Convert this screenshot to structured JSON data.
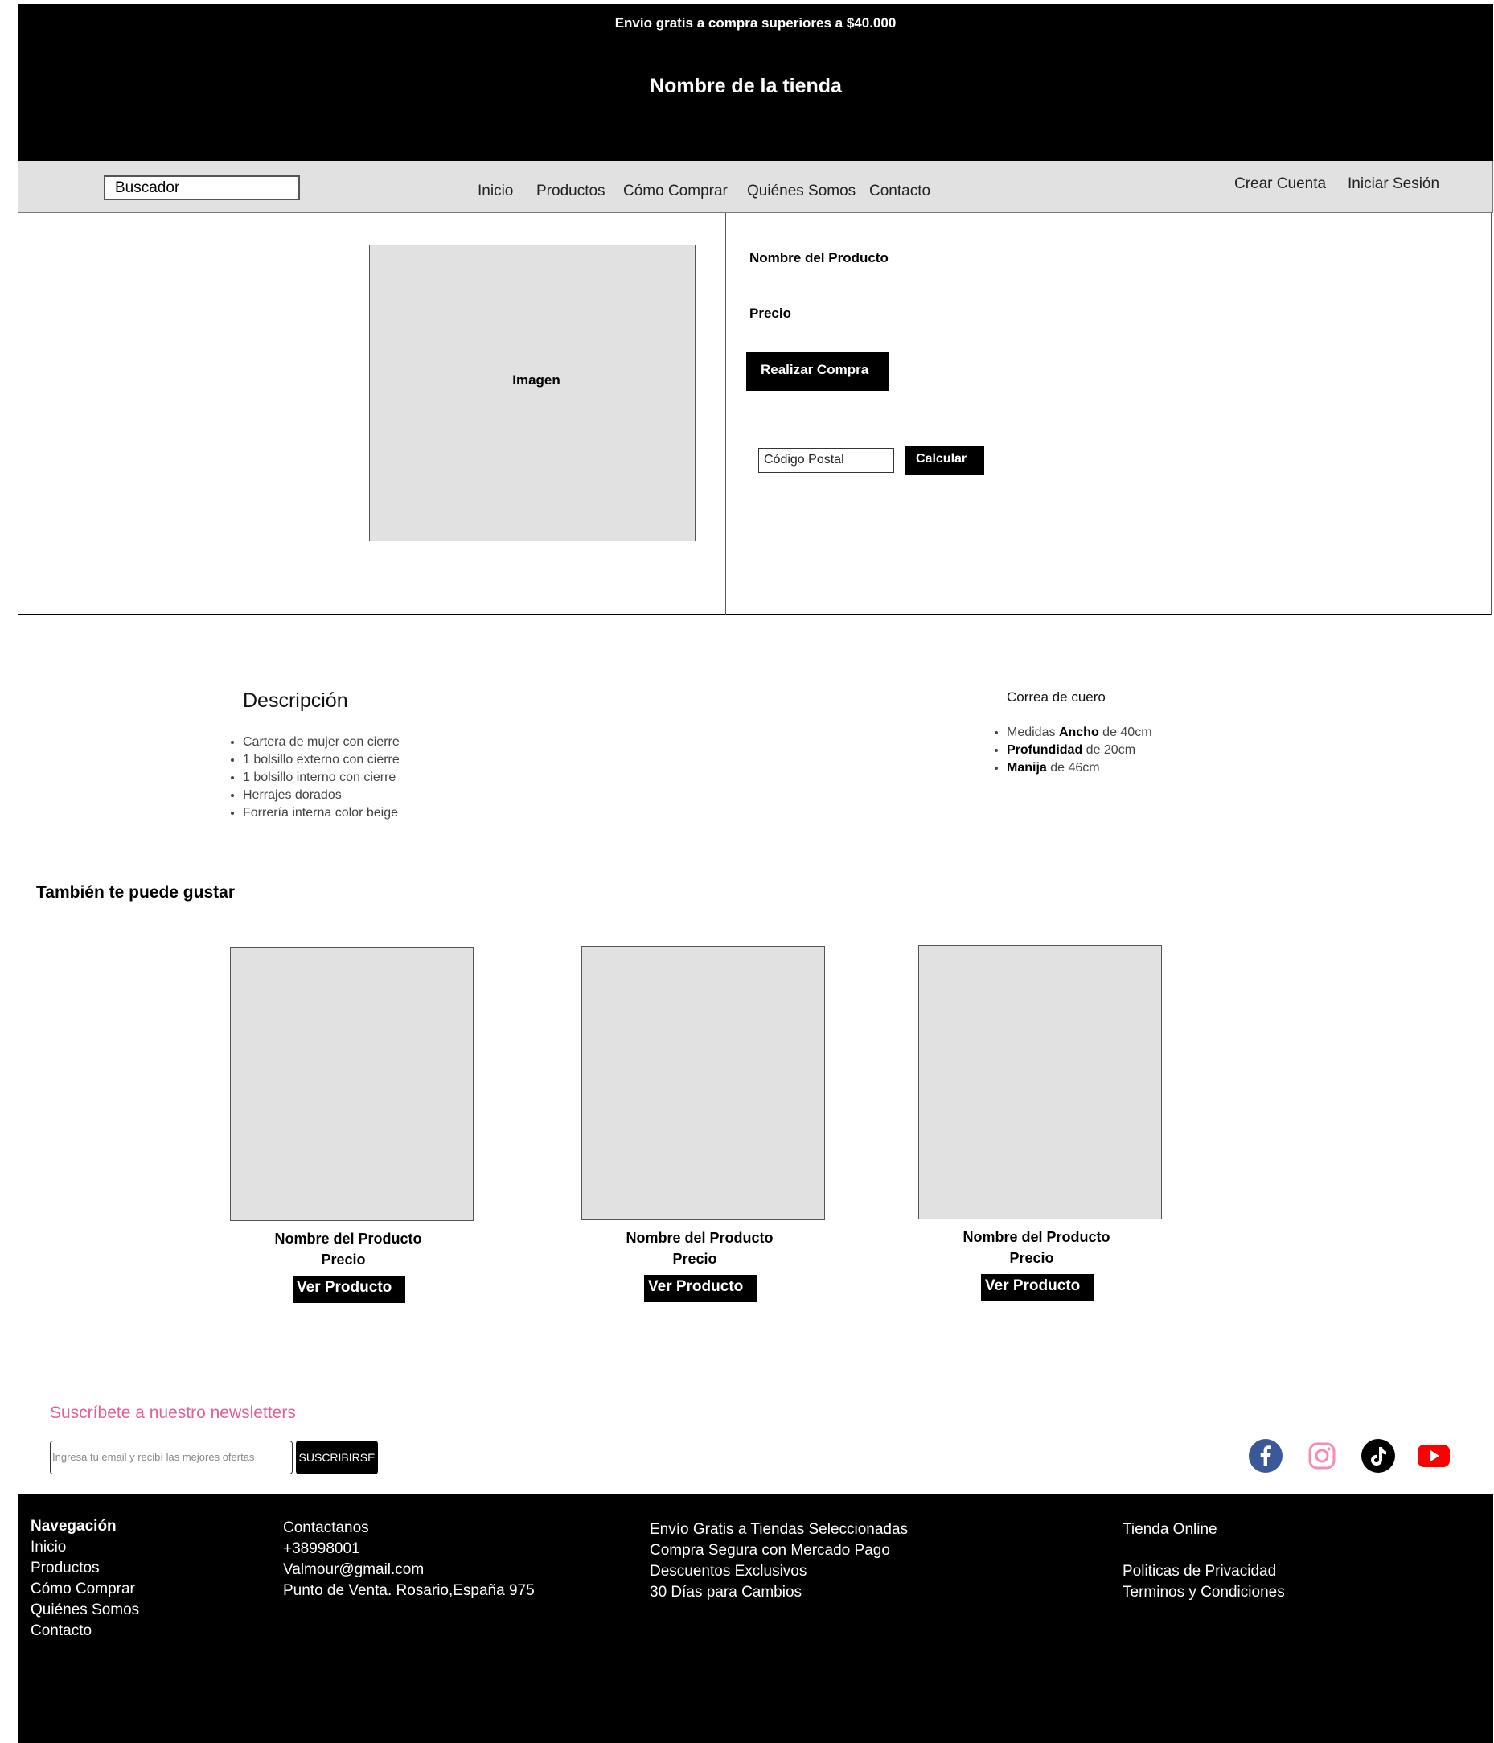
{
  "header": {
    "promo": "Envío gratis a compra superiores a $40.000",
    "store_name": "Nombre de la tienda"
  },
  "nav": {
    "search_placeholder": "Buscador",
    "links": [
      "Inicio",
      "Productos",
      "Cómo Comprar",
      "Quiénes Somos",
      "Contacto"
    ],
    "account": [
      "Crear Cuenta",
      "Iniciar Sesión"
    ]
  },
  "product": {
    "image_label": "Imagen",
    "name": "Nombre del Producto",
    "price": "Precio",
    "buy_button": "Realizar Compra",
    "postal_placeholder": "Código Postal",
    "calc_button": "Calcular"
  },
  "description": {
    "title": "Descripción",
    "items": [
      "Cartera de mujer con cierre",
      "1 bolsillo externo con cierre",
      "1 bolsillo interno con cierre",
      "Herrajes dorados",
      "Forrería interna color beige"
    ],
    "specs_title": "Correa de cuero",
    "specs": [
      {
        "label": "Medidas",
        "bold": "Ancho",
        "rest": " de 40cm"
      },
      {
        "label": "",
        "bold": "Profundidad",
        "rest": " de 20cm"
      },
      {
        "label": "",
        "bold": "Manija",
        "rest": " de 46cm"
      }
    ]
  },
  "related": {
    "title": "También te puede gustar",
    "cards": [
      {
        "name": "Nombre del Producto",
        "price": "Precio",
        "button": "Ver Producto"
      },
      {
        "name": "Nombre del Producto",
        "price": "Precio",
        "button": "Ver Producto"
      },
      {
        "name": "Nombre del Producto",
        "price": "Precio",
        "button": "Ver Producto"
      }
    ]
  },
  "newsletter": {
    "title": "Suscríbete a nuestro newsletters",
    "placeholder": "Ingresa tu email y recibí las mejores ofertas",
    "button": "SUSCRIBIRSE",
    "title_color": "#e0609a"
  },
  "social": [
    {
      "icon": "facebook-icon",
      "color": "#3b5998"
    },
    {
      "icon": "instagram-icon",
      "color": "#f48cb4"
    },
    {
      "icon": "tiktok-icon",
      "color": "#000000"
    },
    {
      "icon": "youtube-icon",
      "color": "#ff0000"
    }
  ],
  "footer": {
    "nav_title": "Navegación",
    "nav_links": [
      "Inicio",
      "Productos",
      "Cómo Comprar",
      "Quiénes Somos",
      "Contacto"
    ],
    "contact": [
      "Contactanos",
      "+38998001",
      "Valmour@gmail.com",
      "Punto de Venta. Rosario,España 975"
    ],
    "benefits": [
      "Envío Gratis a Tiendas Seleccionadas",
      "Compra Segura con Mercado Pago",
      "Descuentos Exclusivos",
      "30 Días para Cambios"
    ],
    "store": "Tienda Online",
    "legal": [
      "Politicas de Privacidad",
      "Terminos y Condiciones"
    ]
  }
}
